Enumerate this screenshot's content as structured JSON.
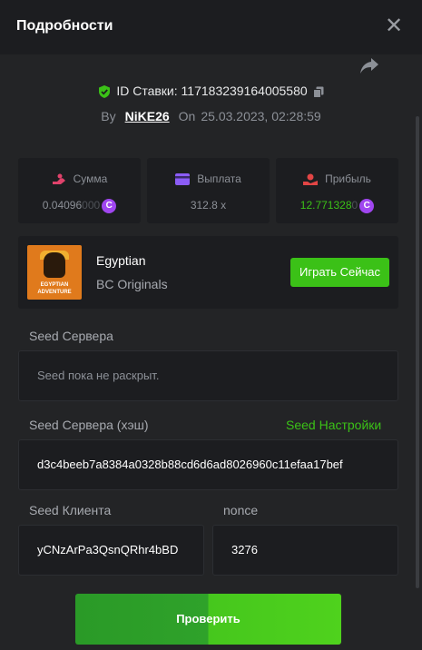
{
  "header": {
    "title": "Подробности",
    "close_icon": "close-icon"
  },
  "bet": {
    "id_label": "ID Ставки:",
    "id_value": "117183239164005580",
    "by_label": "By",
    "user": "NiKE26",
    "on_label": "On",
    "datetime": "25.03.2023, 02:28:59"
  },
  "stats": {
    "amount": {
      "label": "Сумма",
      "value_main": "0.04096",
      "value_dim": "000",
      "coin": "C"
    },
    "payout": {
      "label": "Выплата",
      "value": "312.8 x"
    },
    "profit": {
      "label": "Прибыль",
      "value_main": "12.771328",
      "value_dim": "0",
      "coin": "C"
    }
  },
  "game": {
    "name": "Egyptian",
    "provider": "BC Originals",
    "thumb_text_1": "EGYPTIAN",
    "thumb_text_2": "ADVENTURE",
    "play_label": "Играть Сейчас"
  },
  "fairness": {
    "server_seed_label": "Seed Сервера",
    "server_seed_value": "Seed пока не раскрыт.",
    "server_hash_label": "Seed Сервера (хэш)",
    "seed_settings_label": "Seed Настройки",
    "server_hash_value": "d3c4beeb7a8384a0328b88cd6d6ad8026960c11efaa17bef",
    "client_seed_label": "Seed Клиента",
    "client_seed_value": "yCNzArPa3QsnQRhr4bBD",
    "nonce_label": "nonce",
    "nonce_value": "3276"
  },
  "verify_label": "Проверить",
  "colors": {
    "accent_green": "#3bc117",
    "coin_purple": "#a046f0",
    "amount_pink": "#e0426b",
    "payout_purple": "#8b5cf6",
    "profit_red": "#e24545"
  }
}
